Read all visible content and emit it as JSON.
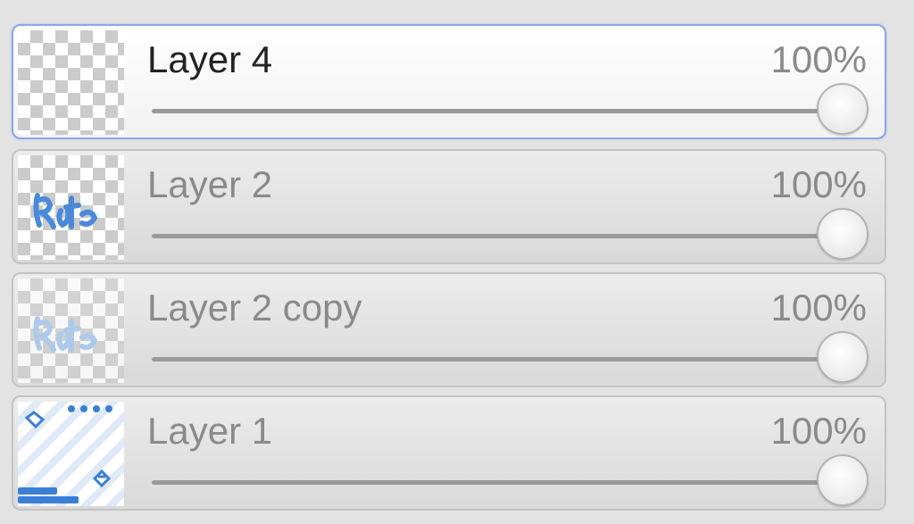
{
  "layers": [
    {
      "name": "Layer 4",
      "opacity_text": "100%",
      "opacity": 1.0,
      "selected": true
    },
    {
      "name": "Layer 2",
      "opacity_text": "100%",
      "opacity": 1.0,
      "selected": false
    },
    {
      "name": "Layer 2 copy",
      "opacity_text": "100%",
      "opacity": 1.0,
      "selected": false
    },
    {
      "name": "Layer 1",
      "opacity_text": "100%",
      "opacity": 1.0,
      "selected": false
    }
  ],
  "colors": {
    "panel_bg": "#e3e3e3",
    "selected_border": "#8aa9e6",
    "row_border": "#c3c3c3",
    "thumbnail_accent": "#3a7fd5"
  }
}
